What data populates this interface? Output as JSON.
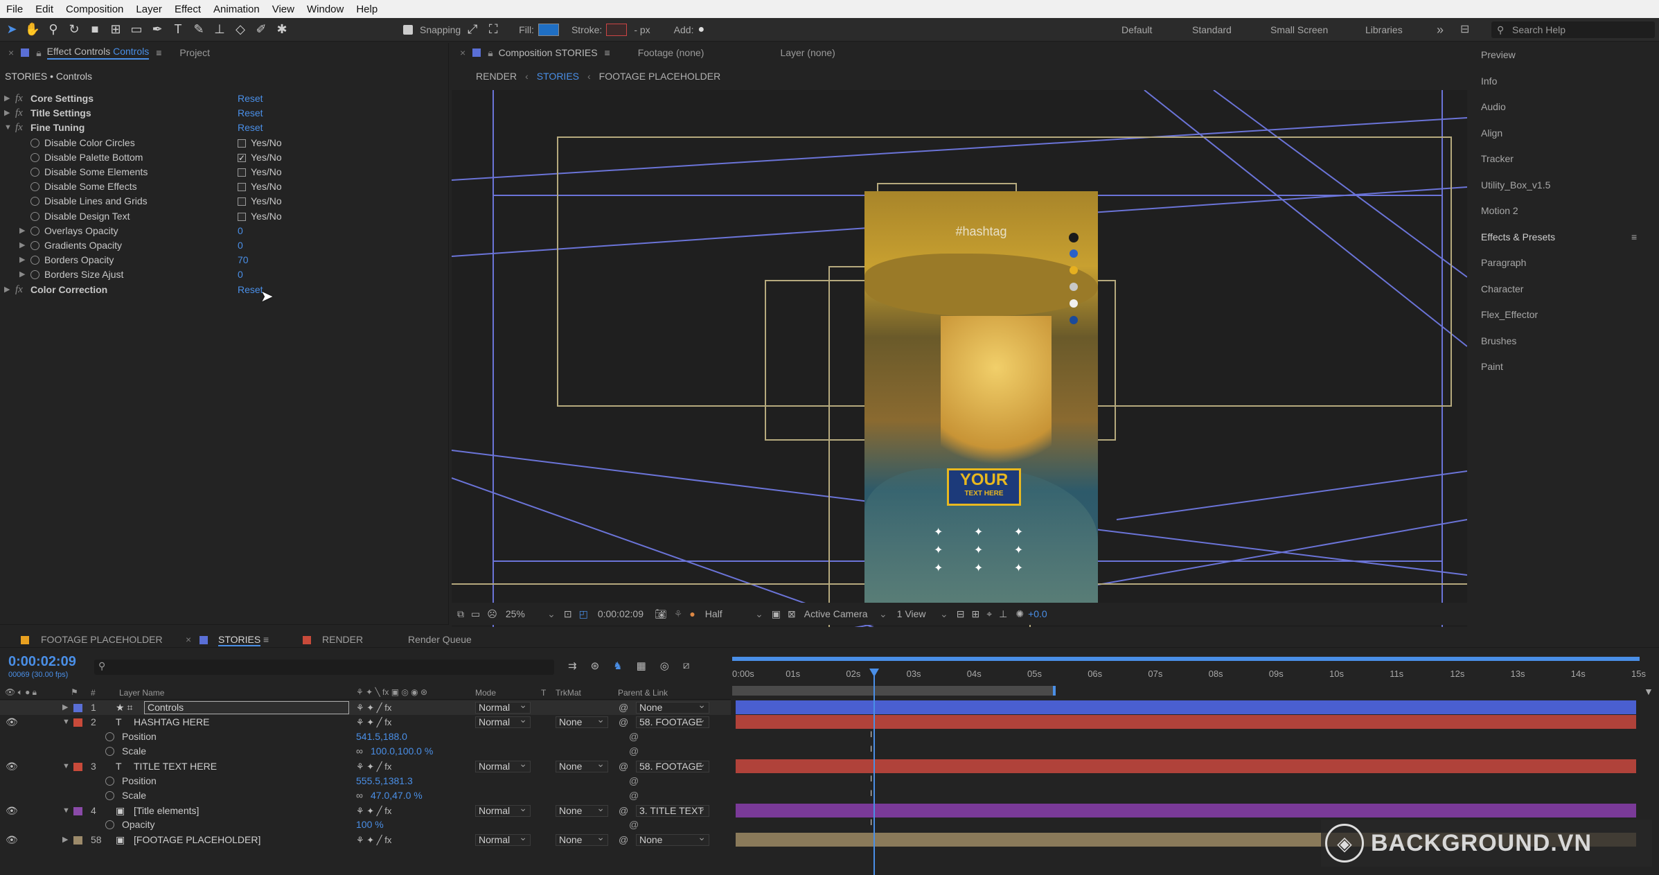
{
  "menu": [
    "File",
    "Edit",
    "Composition",
    "Layer",
    "Effect",
    "Animation",
    "View",
    "Window",
    "Help"
  ],
  "toolbar": {
    "snapping": "Snapping",
    "fill": "Fill:",
    "stroke": "Stroke:",
    "px": "- px",
    "add": "Add:",
    "fill_color": "#1f6fc4",
    "stroke_color": "#c44"
  },
  "workspaces": [
    "Default",
    "Standard",
    "Small Screen",
    "Libraries"
  ],
  "search_placeholder": "Search Help",
  "effect_controls": {
    "tab": "Effect Controls",
    "tab_target": "Controls",
    "project_tab": "Project",
    "header": "STORIES • Controls",
    "rows": [
      {
        "name": "Core Settings",
        "value": "Reset"
      },
      {
        "name": "Title Settings",
        "value": "Reset"
      },
      {
        "name": "Fine Tuning",
        "value": "Reset"
      },
      {
        "name": "Disable Color Circles",
        "value": "Yes/No"
      },
      {
        "name": "Disable Palette Bottom",
        "value": "Yes/No"
      },
      {
        "name": "Disable Some Elements",
        "value": "Yes/No"
      },
      {
        "name": "Disable Some Effects",
        "value": "Yes/No"
      },
      {
        "name": "Disable Lines and Grids",
        "value": "Yes/No"
      },
      {
        "name": "Disable Design Text",
        "value": "Yes/No"
      },
      {
        "name": "Overlays Opacity",
        "value": "0"
      },
      {
        "name": "Gradients Opacity",
        "value": "0"
      },
      {
        "name": "Borders Opacity",
        "value": "70"
      },
      {
        "name": "Borders Size Ajust",
        "value": "0"
      },
      {
        "name": "Color Correction",
        "value": "Reset"
      }
    ]
  },
  "composition": {
    "tab": "Composition STORIES",
    "footage_tab": "Footage (none)",
    "layer_tab": "Layer (none)",
    "breadcrumbs": [
      "RENDER",
      "STORIES",
      "FOOTAGE PLACEHOLDER"
    ],
    "hashtag": "#hashtag",
    "your_text": "YOUR",
    "your_sub": "TEXT HERE"
  },
  "viewer_bar": {
    "zoom": "25%",
    "timecode": "0:00:02:09",
    "resolution": "Half",
    "camera": "Active Camera",
    "views": "1 View",
    "exposure": "+0.0"
  },
  "right_panels": [
    "Preview",
    "Info",
    "Audio",
    "Align",
    "Tracker",
    "Utility_Box_v1.5",
    "Motion 2",
    "Effects & Presets",
    "Paragraph",
    "Character",
    "Flex_Effector",
    "Brushes",
    "Paint"
  ],
  "timeline": {
    "tabs": [
      "FOOTAGE PLACEHOLDER",
      "STORIES",
      "RENDER",
      "Render Queue"
    ],
    "timecode": "0:00:02:09",
    "frames": "00069 (30.00 fps)",
    "headers": {
      "layer_name": "Layer Name",
      "mode": "Mode",
      "t": "T",
      "trkmat": "TrkMat",
      "parent": "Parent & Link",
      "num": "#"
    },
    "ruler": [
      "0:00s",
      "01s",
      "02s",
      "03s",
      "04s",
      "05s",
      "06s",
      "07s",
      "08s",
      "09s",
      "10s",
      "11s",
      "12s",
      "13s",
      "14s",
      "15s"
    ],
    "layers": [
      {
        "num": "1",
        "name": "Controls",
        "mode": "Normal",
        "trkmat": "",
        "parent": "None",
        "color": "#5a6fd6"
      },
      {
        "num": "2",
        "name": "HASHTAG HERE",
        "mode": "Normal",
        "trkmat": "None",
        "parent": "58. FOOTAGE",
        "color": "#c84a3a"
      },
      {
        "num": "3",
        "name": "TITLE TEXT HERE",
        "mode": "Normal",
        "trkmat": "None",
        "parent": "58. FOOTAGE",
        "color": "#c84a3a"
      },
      {
        "num": "4",
        "name": "[Title elements]",
        "mode": "Normal",
        "trkmat": "None",
        "parent": "3. TITLE TEXT",
        "color": "#8a4aa8"
      },
      {
        "num": "58",
        "name": "[FOOTAGE PLACEHOLDER]",
        "mode": "Normal",
        "trkmat": "None",
        "parent": "None",
        "color": "#9c8a6a"
      }
    ],
    "props": {
      "position": "Position",
      "scale": "Scale",
      "opacity": "Opacity",
      "l2_pos": "541.5,188.0",
      "l2_scale": "100.0,100.0 %",
      "l3_pos": "555.5,1381.3",
      "l3_scale": "47.0,47.0 %",
      "l4_opacity": "100 %"
    }
  },
  "watermark": "BACKGROUND.VN"
}
